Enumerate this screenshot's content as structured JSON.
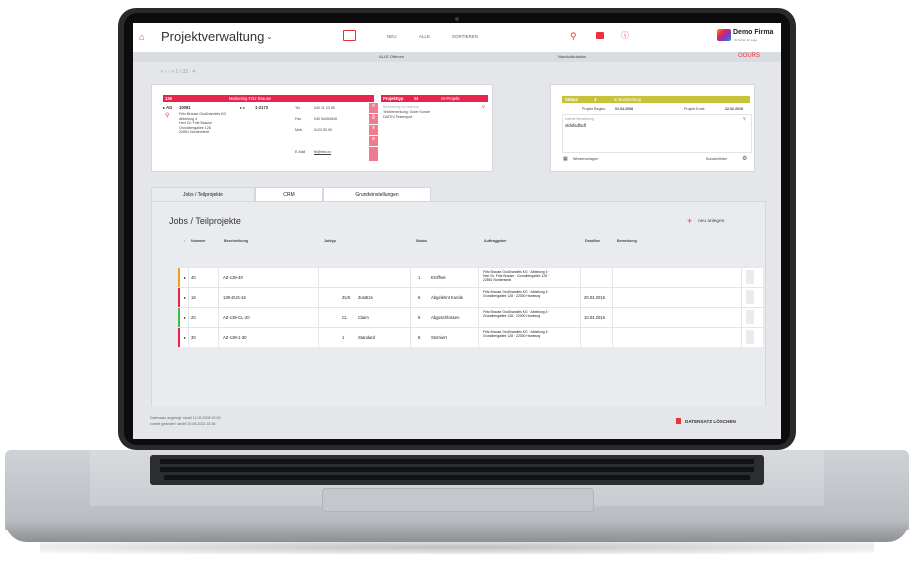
{
  "header": {
    "title": "Projektverwaltung",
    "nav": [
      "NEU",
      "ALLE",
      "SORTIEREN"
    ],
    "company": "Demo Firma",
    "company_sub": "Ihr Schön Ihr Logo",
    "sub_center": "ALLE Offenen",
    "sub_right_label": "Nachkalkulation",
    "brand": "OOURS"
  },
  "pager": "« ‹ › » 1 / 33 · 4",
  "project": {
    "number": "139",
    "title": "Marketing Fritz Brause",
    "ag_label": "▸ AG",
    "ag_number": "10081",
    "ap_number": "1-2173",
    "address": [
      "Fritz Brause Großhandels KG",
      "Abteilung 4",
      "Herr Dr. Fritz Brause",
      "Grundbergallee 128",
      "22851 Norderstedt"
    ],
    "tel_label": "Tel.",
    "tel": "040 11 23 55",
    "fax_label": "Fax.",
    "fax": "040 54454545",
    "mob_label": "Mob.",
    "mob": "0123 55 00",
    "email_label": "E-Mail",
    "email": "fb@test.xx",
    "type_label": "Projekttyp",
    "type_code": "SI",
    "type_name": "SI-Projekt",
    "remark_placeholder": "Bemerkung zur Adresse",
    "remark": [
      "Testbemerkung: Guter Kunde",
      "DATEV-Testexport"
    ]
  },
  "status": {
    "label": "Status",
    "value": "3",
    "text": "in Bearbeitung",
    "start_label": "Projekt Beginn",
    "start": "01.04.2008",
    "end_label": "Projekt Ende",
    "end": "22.02.2019",
    "note_label": "Interne Bemerkung",
    "note": "sfdsfsdfsdf",
    "recurring": "Wiedervorlagen",
    "customer_fields": "Kundenfelder"
  },
  "tabs": [
    "Jobs / Teilprojekte",
    "CRM",
    "Grundeinstellungen"
  ],
  "jobs": {
    "heading": "Jobs / Teilprojekte",
    "add_label": "neu anlegen",
    "columns": [
      "Nummer",
      "Beschreibung",
      "Jobtyp",
      "Status",
      "Auftraggeber",
      "Deadline",
      "Bemerkung"
    ],
    "rows": [
      {
        "nr": "40",
        "desc": "AZ-139-40",
        "type": "",
        "type_name": "",
        "status_nr": "1",
        "status": "Eröffnet",
        "client": [
          "Fritz Brause Großhandels KG · Abteilung 4 ·",
          "Herr Dr. Fritz Brause · Grundbergallee 128 ·",
          "22851 Norderstedt"
        ],
        "deadline": "",
        "color": "#e8a020"
      },
      {
        "nr": "16",
        "desc": "139-ZUS-16",
        "type": "ZUS",
        "type_name": "Zusätze",
        "status_nr": "6",
        "status": "Abgelehnt Kunde",
        "client": [
          "Fritz Brause Großhandels KG · Abteilung 4 ·",
          "Grundbergallee 128 · 22000 Hamburg"
        ],
        "deadline": "20.04.2016",
        "color": "#e8244e"
      },
      {
        "nr": "20",
        "desc": "AZ-139-CL-20",
        "type": "CL",
        "type_name": "Claim",
        "status_nr": "9",
        "status": "Abgeschlossen",
        "client": [
          "Fritz Brause Großhandels KG · Abteilung 4 ·",
          "Grundbergallee 128 · 22000 Hamburg"
        ],
        "deadline": "10.04.2016",
        "color": "#3cbf4a"
      },
      {
        "nr": "30",
        "desc": "AZ-139-1-30",
        "type": "1",
        "type_name": "Standard",
        "status_nr": "8",
        "status": "Storniert",
        "client": [
          "Fritz Brause Großhandels KG · Abteilung 4 ·",
          "Grundbergallee 128 · 22000 Hamburg"
        ],
        "deadline": "",
        "color": "#e8244e"
      }
    ]
  },
  "footer": {
    "created": "Datensatz angelegt:  strobl    11.09.2008 20:09",
    "changed": "zuletzt geändert:    strobl    20.08.2023 15:38",
    "delete_label": "DATENSATZ LÖSCHEN"
  },
  "colors": {
    "accent": "#e8244e",
    "status_bar": "#c8c23a",
    "background": "#e4e6ea"
  }
}
